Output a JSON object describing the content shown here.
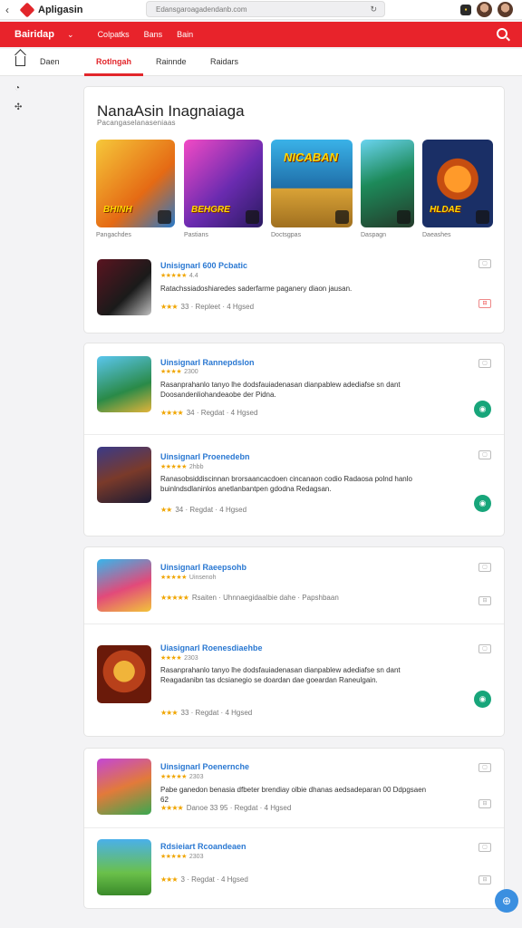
{
  "browser": {
    "title": "Apligasin",
    "url": "Edansgaroagadendanb.com"
  },
  "redbar": {
    "dropdown": "Bairidap",
    "nav": [
      "Colpatks",
      "Bans",
      "Bain"
    ]
  },
  "tabs": [
    "Daen",
    "Rotlngah",
    "Rainnde",
    "Raidars"
  ],
  "featured": {
    "title": "NanaAsin Inagnaiaga",
    "subtitle": "Pacangaselanaseniaas",
    "tiles": [
      {
        "label": "BHINH",
        "caption": "Pangachdes",
        "bg": "#f2b31d"
      },
      {
        "label": "BEHGRE",
        "caption": "Pastians",
        "bg": "#7b2fa8"
      },
      {
        "label": "NICABAN",
        "caption": "Doctsgpas",
        "bg": "#2a9bd8"
      },
      {
        "label": "",
        "caption": "Daspagn",
        "bg": "#1c7a4a"
      },
      {
        "label": "HLDAE",
        "caption": "Daeashes",
        "bg": "#1a3d7a"
      }
    ]
  },
  "groups": [
    [
      {
        "title": "Unisignarl 600 Pcbatic",
        "stars": "★★★★★",
        "rating": "4.4",
        "desc": "Ratachssiadoshiaredes saderfarme paganery diaon jausan.",
        "meta_stars": "★★★",
        "meta": [
          "33",
          "Repleet",
          "4 Hgsed"
        ],
        "thumb": "#3a1a22",
        "action": "square"
      }
    ],
    [
      {
        "title": "Uinsignarl Rannepdslon",
        "stars": "★★★★",
        "rating": "2300",
        "desc": "Rasanprahanlo tanyo lhe dodsfauiadenasan dianpablew adediafse sn dant Doosandenliohandeaobe der Pidna.",
        "meta_stars": "★★★★",
        "meta": [
          "34",
          "Regdat",
          "4 Hgsed"
        ],
        "thumb": "#2e9bd6",
        "action": "green"
      },
      {
        "title": "Uinsignarl Proenedebn",
        "stars": "★★★★★",
        "rating": "2hbb",
        "desc": "Ranasobsiddiscinnan brorsaancacdoen cincanaon codio Radaosa polnd hanlo buinlndsdlaninlos anetlanbantpen gdodna Redagsan.",
        "meta_stars": "★★",
        "meta": [
          "34",
          "Regdat",
          "4 Hgsed"
        ],
        "thumb": "#3b2a66",
        "action": "green"
      }
    ],
    [
      {
        "title": "Uinsignarl Raeepsohb",
        "stars": "★★★★★",
        "rating": "Uinsenoh",
        "desc": "",
        "meta_stars": "★★★★★",
        "meta": [
          "Rsaiten",
          "Uhnnaegidaalbie dahe",
          "Papshbaan"
        ],
        "thumb": "#2fb0e4",
        "action": "square"
      },
      {
        "title": "Uiasignarl Roenesdiaehbe",
        "stars": "★★★★",
        "rating": "2303",
        "desc": "Rasanprahanlo tanyo lhe dodsfauiadenasan dianpablew adediafse sn dant Reagadanibn tas dcsianegio se doardan dae goeardan Raneulgain.",
        "meta_stars": "★★★",
        "meta": [
          "33",
          "Regdat",
          "4 Hgsed"
        ],
        "thumb": "#c84a1a",
        "action": "green"
      }
    ],
    [
      {
        "title": "Uinsignarl Poenernche",
        "stars": "★★★★★",
        "rating": "2303",
        "desc": "Pabe ganedon benasia dfbeter brendiay olbie dhanas aedsadeparan 00 Ddpgsaen 62",
        "meta_stars": "★★★★",
        "meta": [
          "Danoe 33 95",
          "Regdat",
          "4 Hgsed"
        ],
        "thumb": "#b03ec6",
        "action": "square"
      },
      {
        "title": "Rdsieiart Rcoandeaen",
        "stars": "★★★★★",
        "rating": "2303",
        "desc": "",
        "meta_stars": "★★★",
        "meta": [
          "3",
          "Regdat",
          "4 Hgsed"
        ],
        "thumb": "#4aa6e0",
        "action": "square"
      }
    ]
  ]
}
